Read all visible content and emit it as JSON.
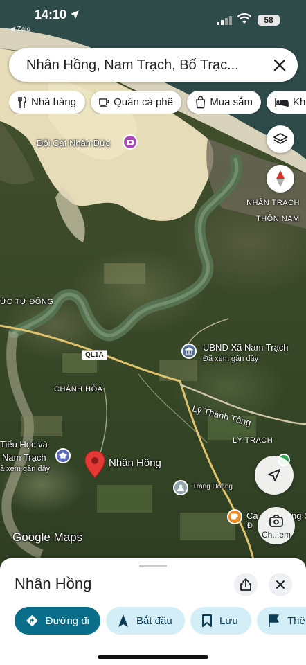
{
  "status_bar": {
    "time": "14:10",
    "back_app": "◀ Zalo",
    "battery": "58"
  },
  "search": {
    "query": "Nhân Hồng, Nam Trạch, Bố Trạc..."
  },
  "chips": [
    {
      "label": "Nhà hàng",
      "icon": "utensils-icon"
    },
    {
      "label": "Quán cà phê",
      "icon": "coffee-icon"
    },
    {
      "label": "Mua sắm",
      "icon": "shopping-bag-icon"
    },
    {
      "label": "Khá",
      "icon": "bed-icon"
    }
  ],
  "map": {
    "labels": {
      "doi_cat": "Đồi Cát Nhân Đức",
      "nhan_trach": "NHÂN TRẠCH",
      "thon_nam": "THÔN NAM",
      "tu_dong": "ỨC TỰ ĐÔNG",
      "ubnd": "UBND Xã Nam Trạch",
      "ubnd_sub": "Đã xem gần đây",
      "road": "QL1A",
      "chanh_hoa": "CHÁNH HÒA",
      "ly_thanh_tong": "Lý Thánh Tông",
      "ly_trach": "LÝ TRẠCH",
      "school_1": "Tiểu Học và",
      "school_2": "Nam Trạch",
      "school_sub": "ã xem gần đây",
      "pin": "Nhân Hồng",
      "trang_hoang": "Trang Hoàng",
      "cafe": "Ca",
      "cafe_right": "ng S",
      "cafe_sub": "Đ",
      "lens": "Ch...em"
    },
    "logo": "Google Maps"
  },
  "sheet": {
    "title": "Nhân Hồng",
    "actions": [
      {
        "label": "Đường đi",
        "icon": "directions-icon"
      },
      {
        "label": "Bắt đầu",
        "icon": "navigation-arrow-icon"
      },
      {
        "label": "Lưu",
        "icon": "bookmark-icon"
      },
      {
        "label": "Thê",
        "icon": "flag-icon"
      }
    ]
  },
  "colors": {
    "primary": "#0a6e8a",
    "secondary": "#d4eef8",
    "pin": "#e53935",
    "poi": "#5c6bc0"
  }
}
